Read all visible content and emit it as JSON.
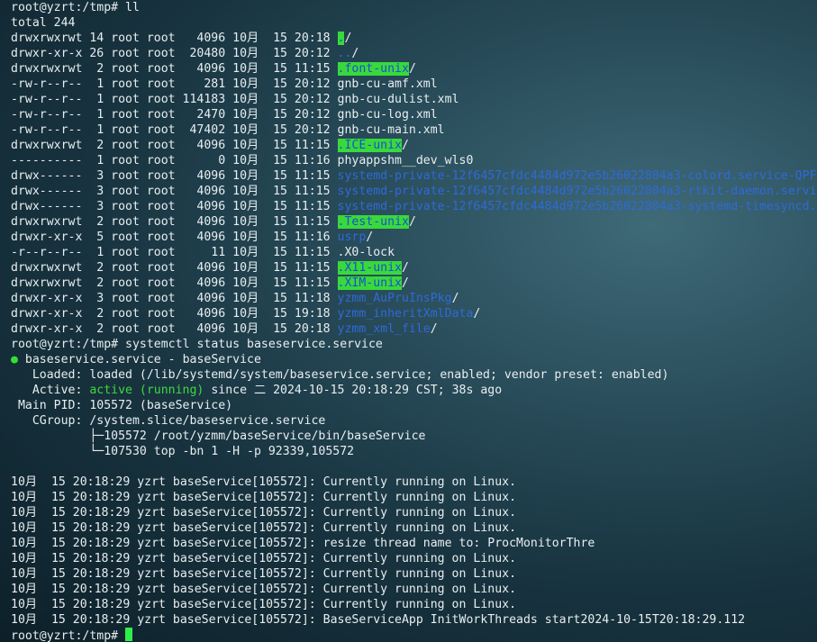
{
  "terminal": {
    "prompt": "root@yzrt:/tmp#",
    "cmd_ll": "ll",
    "total": "total 244",
    "listing": [
      {
        "meta": "drwxrwxrwt 14 root root   4096 10月  15 20:18 ",
        "name": ".",
        "suffix": "/",
        "style": "hl"
      },
      {
        "meta": "drwxr-xr-x 26 root root  20480 10月  15 20:12 ",
        "name": "..",
        "suffix": "/",
        "style": "blue"
      },
      {
        "meta": "drwxrwxrwt  2 root root   4096 10月  15 11:15 ",
        "name": ".font-unix",
        "suffix": "/",
        "style": "hl"
      },
      {
        "meta": "-rw-r--r--  1 root root    281 10月  15 20:12 ",
        "name": "gnb-cu-amf.xml",
        "suffix": "",
        "style": "plain"
      },
      {
        "meta": "-rw-r--r--  1 root root 114183 10月  15 20:12 ",
        "name": "gnb-cu-dulist.xml",
        "suffix": "",
        "style": "plain"
      },
      {
        "meta": "-rw-r--r--  1 root root   2470 10月  15 20:12 ",
        "name": "gnb-cu-log.xml",
        "suffix": "",
        "style": "plain"
      },
      {
        "meta": "-rw-r--r--  1 root root  47402 10月  15 20:12 ",
        "name": "gnb-cu-main.xml",
        "suffix": "",
        "style": "plain"
      },
      {
        "meta": "drwxrwxrwt  2 root root   4096 10月  15 11:15 ",
        "name": ".ICE-unix",
        "suffix": "/",
        "style": "hl"
      },
      {
        "meta": "----------  1 root root      0 10月  15 11:16 ",
        "name": "phyappshm__dev_wls0",
        "suffix": "",
        "style": "plain"
      },
      {
        "meta": "drwx------  3 root root   4096 10月  15 11:15 ",
        "name": "systemd-private-12f6457cfdc4484d972e5b26022804a3-colord.service-QPF",
        "suffix": "",
        "style": "blue"
      },
      {
        "meta": "drwx------  3 root root   4096 10月  15 11:15 ",
        "name": "systemd-private-12f6457cfdc4484d972e5b26022804a3-rtkit-daemon.servi",
        "suffix": "",
        "style": "blue"
      },
      {
        "meta": "drwx------  3 root root   4096 10月  15 11:15 ",
        "name": "systemd-private-12f6457cfdc4484d972e5b26022804a3-systemd-timesyncd.",
        "suffix": "",
        "style": "blue"
      },
      {
        "meta": "drwxrwxrwt  2 root root   4096 10月  15 11:15 ",
        "name": ".Test-unix",
        "suffix": "/",
        "style": "hl"
      },
      {
        "meta": "drwxr-xr-x  5 root root   4096 10月  15 11:16 ",
        "name": "usrp",
        "suffix": "/",
        "style": "blue"
      },
      {
        "meta": "-r--r--r--  1 root root     11 10月  15 11:15 ",
        "name": ".X0-lock",
        "suffix": "",
        "style": "plain"
      },
      {
        "meta": "drwxrwxrwt  2 root root   4096 10月  15 11:15 ",
        "name": ".X11-unix",
        "suffix": "/",
        "style": "hl"
      },
      {
        "meta": "drwxrwxrwt  2 root root   4096 10月  15 11:15 ",
        "name": ".XIM-unix",
        "suffix": "/",
        "style": "hl"
      },
      {
        "meta": "drwxr-xr-x  3 root root   4096 10月  15 11:18 ",
        "name": "yzmm_AuPruInsPkg",
        "suffix": "/",
        "style": "blue"
      },
      {
        "meta": "drwxr-xr-x  2 root root   4096 10月  15 19:18 ",
        "name": "yzmm_inheritXmlData",
        "suffix": "/",
        "style": "blue"
      },
      {
        "meta": "drwxr-xr-x  2 root root   4096 10月  15 20:18 ",
        "name": "yzmm_xml_file",
        "suffix": "/",
        "style": "blue"
      }
    ],
    "cmd_status": "systemctl status baseservice.service",
    "status": {
      "bullet": "●",
      "header": " baseservice.service - baseService",
      "loaded": "   Loaded: loaded (/lib/systemd/system/baseservice.service; enabled; vendor preset: enabled)",
      "active_label": "   Active: ",
      "active_state": "active (running)",
      "active_rest": " since 二 2024-10-15 20:18:29 CST; 38s ago",
      "main_pid": " Main PID: 105572 (baseService)",
      "cgroup": "   CGroup: /system.slice/baseservice.service",
      "cgroup_child1": "           ├─105572 /root/yzmm/baseService/bin/baseService",
      "cgroup_child2": "           └─107530 top -bn 1 -H -p 92339,105572"
    },
    "logs": [
      "10月  15 20:18:29 yzrt baseService[105572]: Currently running on Linux.",
      "10月  15 20:18:29 yzrt baseService[105572]: Currently running on Linux.",
      "10月  15 20:18:29 yzrt baseService[105572]: Currently running on Linux.",
      "10月  15 20:18:29 yzrt baseService[105572]: Currently running on Linux.",
      "10月  15 20:18:29 yzrt baseService[105572]: resize thread name to: ProcMonitorThre",
      "10月  15 20:18:29 yzrt baseService[105572]: Currently running on Linux.",
      "10月  15 20:18:29 yzrt baseService[105572]: Currently running on Linux.",
      "10月  15 20:18:29 yzrt baseService[105572]: Currently running on Linux.",
      "10月  15 20:18:29 yzrt baseService[105572]: Currently running on Linux.",
      "10月  15 20:18:29 yzrt baseService[105572]: BaseServiceApp InitWorkThreads start2024-10-15T20:18:29.112"
    ],
    "colors": {
      "background": "#1f404d",
      "text": "#e8eef0",
      "dir_highlight_bg": "#39d93c",
      "dir_highlight_fg": "#1b4fcf",
      "dir_blue": "#2e6ad8",
      "active_green": "#41d741",
      "cursor": "#2cf04a"
    }
  }
}
